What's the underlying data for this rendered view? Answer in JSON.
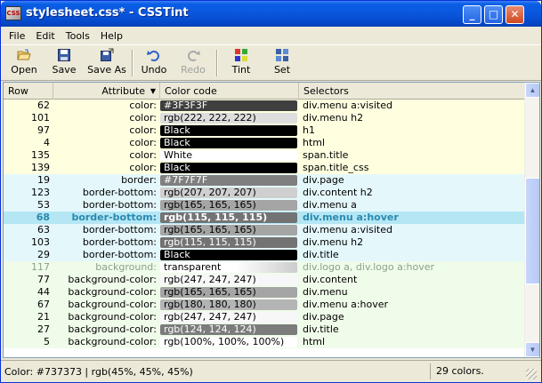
{
  "window": {
    "title": "stylesheet.css* - CSSTint",
    "app_icon_text": "CSS",
    "controls": {
      "minimize": "_",
      "maximize": "□",
      "close": "✕"
    }
  },
  "menu": [
    "File",
    "Edit",
    "Tools",
    "Help"
  ],
  "toolbar": [
    {
      "label": "Open",
      "icon": "open-folder-icon",
      "enabled": true
    },
    {
      "label": "Save",
      "icon": "floppy-disk-icon",
      "enabled": true
    },
    {
      "label": "Save As",
      "icon": "save-as-icon",
      "enabled": true
    },
    {
      "label": "Undo",
      "icon": "undo-icon",
      "enabled": true
    },
    {
      "label": "Redo",
      "icon": "redo-icon",
      "enabled": false
    },
    {
      "label": "Tint",
      "icon": "tint-icon",
      "enabled": true
    },
    {
      "label": "Set",
      "icon": "set-icon",
      "enabled": true
    }
  ],
  "columns": {
    "row": "Row",
    "attribute": "Attribute",
    "color_code": "Color code",
    "selectors": "Selectors",
    "sort_indicator": "▼"
  },
  "rows": [
    {
      "row": "62",
      "attr": "color:",
      "code": "#3F3F3F",
      "bg": "#3f3f3f",
      "fg": "#ffffff",
      "sel": "div.menu a:visited",
      "band": "y"
    },
    {
      "row": "101",
      "attr": "color:",
      "code": "rgb(222, 222, 222)",
      "bg": "#dedede",
      "fg": "#000000",
      "sel": "div.menu h2",
      "band": "y"
    },
    {
      "row": "97",
      "attr": "color:",
      "code": "Black",
      "bg": "#000000",
      "fg": "#ffffff",
      "sel": "h1",
      "band": "y"
    },
    {
      "row": "4",
      "attr": "color:",
      "code": "Black",
      "bg": "#000000",
      "fg": "#ffffff",
      "sel": "html",
      "band": "y"
    },
    {
      "row": "135",
      "attr": "color:",
      "code": "White",
      "bg": "#ffffff",
      "fg": "#000000",
      "sel": "span.title",
      "band": "y"
    },
    {
      "row": "139",
      "attr": "color:",
      "code": "Black",
      "bg": "#000000",
      "fg": "#ffffff",
      "sel": "span.title_css",
      "band": "y"
    },
    {
      "row": "19",
      "attr": "border:",
      "code": "#7F7F7F",
      "bg": "#7f7f7f",
      "fg": "#ffffff",
      "sel": "div.page",
      "band": "b"
    },
    {
      "row": "123",
      "attr": "border-bottom:",
      "code": "rgb(207, 207, 207)",
      "bg": "#cfcfcf",
      "fg": "#000000",
      "sel": "div.content h2",
      "band": "b"
    },
    {
      "row": "53",
      "attr": "border-bottom:",
      "code": "rgb(165, 165, 165)",
      "bg": "#a5a5a5",
      "fg": "#000000",
      "sel": "div.menu a",
      "band": "b"
    },
    {
      "row": "68",
      "attr": "border-bottom:",
      "code": "rgb(115, 115, 115)",
      "bg": "#737373",
      "fg": "#ffffff",
      "sel": "div.menu a:hover",
      "band": "sel"
    },
    {
      "row": "63",
      "attr": "border-bottom:",
      "code": "rgb(165, 165, 165)",
      "bg": "#a5a5a5",
      "fg": "#000000",
      "sel": "div.menu a:visited",
      "band": "b"
    },
    {
      "row": "103",
      "attr": "border-bottom:",
      "code": "rgb(115, 115, 115)",
      "bg": "#737373",
      "fg": "#ffffff",
      "sel": "div.menu h2",
      "band": "b"
    },
    {
      "row": "29",
      "attr": "border-bottom:",
      "code": "Black",
      "bg": "#000000",
      "fg": "#ffffff",
      "sel": "div.title",
      "band": "b"
    },
    {
      "row": "117",
      "attr": "background:",
      "code": "transparent",
      "bg": "linear-gradient(to right,#ffffff 55%,#cccccc)",
      "fg": "#000000",
      "sel": "div.logo a, div.logo a:hover",
      "band": "g dim"
    },
    {
      "row": "77",
      "attr": "background-color:",
      "code": "rgb(247, 247, 247)",
      "bg": "#f7f7f7",
      "fg": "#000000",
      "sel": "div.content",
      "band": "g"
    },
    {
      "row": "44",
      "attr": "background-color:",
      "code": "rgb(165, 165, 165)",
      "bg": "#a5a5a5",
      "fg": "#000000",
      "sel": "div.menu",
      "band": "g"
    },
    {
      "row": "67",
      "attr": "background-color:",
      "code": "rgb(180, 180, 180)",
      "bg": "#b4b4b4",
      "fg": "#000000",
      "sel": "div.menu a:hover",
      "band": "g"
    },
    {
      "row": "21",
      "attr": "background-color:",
      "code": "rgb(247, 247, 247)",
      "bg": "#f7f7f7",
      "fg": "#000000",
      "sel": "div.page",
      "band": "g"
    },
    {
      "row": "27",
      "attr": "background-color:",
      "code": "rgb(124, 124, 124)",
      "bg": "#7c7c7c",
      "fg": "#ffffff",
      "sel": "div.title",
      "band": "g"
    },
    {
      "row": "5",
      "attr": "background-color:",
      "code": "rgb(100%, 100%, 100%)",
      "bg": "#ffffff",
      "fg": "#000000",
      "sel": "html",
      "band": "g"
    }
  ],
  "status": {
    "left": "Color: #737373 | rgb(45%, 45%, 45%)",
    "right": "29 colors."
  }
}
